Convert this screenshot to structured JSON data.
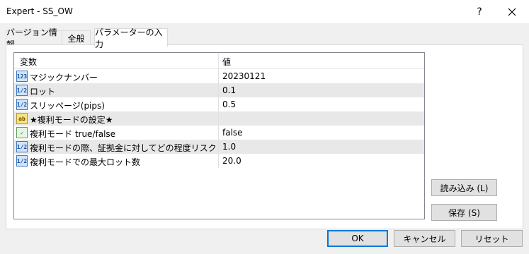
{
  "window": {
    "title": "Expert - SS_OW",
    "help_label": "?",
    "close_label": "✕"
  },
  "tabs": [
    {
      "label": "バージョン情報"
    },
    {
      "label": "全般"
    },
    {
      "label": "パラメーターの入力"
    }
  ],
  "grid": {
    "header_variable": "変数",
    "header_value": "値",
    "rows": [
      {
        "icon": "integer-icon",
        "icon_text": "123",
        "name": "マジックナンバー",
        "value": "20230121"
      },
      {
        "icon": "double-icon",
        "icon_text": "1/2",
        "name": "ロット",
        "value": "0.1"
      },
      {
        "icon": "double-icon",
        "icon_text": "1/2",
        "name": "スリッページ(pips)",
        "value": "0.5"
      },
      {
        "icon": "string-icon",
        "icon_text": "ab",
        "name": "★複利モードの設定★",
        "value": ""
      },
      {
        "icon": "bool-icon",
        "icon_text": "✓",
        "name": "複利モード true/false",
        "value": "false"
      },
      {
        "icon": "double-icon",
        "icon_text": "1/2",
        "name": "複利モードの際、証拠金に対してどの程度リスク(%)を・..",
        "value": "1.0"
      },
      {
        "icon": "double-icon",
        "icon_text": "1/2",
        "name": "複利モードでの最大ロット数",
        "value": "20.0"
      }
    ]
  },
  "buttons": {
    "load": "読み込み (L)",
    "save": "保存 (S)",
    "ok": "OK",
    "cancel": "キャンセル",
    "reset": "リセット"
  }
}
